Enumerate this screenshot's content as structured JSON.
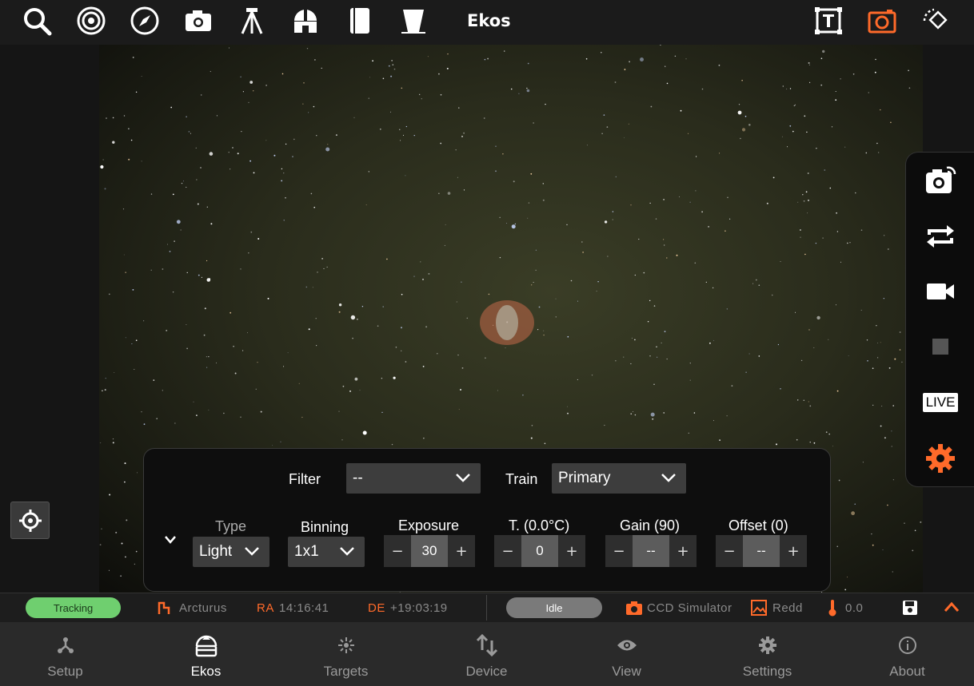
{
  "app": {
    "title": "Ekos"
  },
  "top_icons": [
    "search-icon",
    "target-icon",
    "compass-icon",
    "camera-icon",
    "tripod-icon",
    "observatory-icon",
    "notebook-icon",
    "flat-panel-icon"
  ],
  "top_right_icons": [
    "text-annotation-icon",
    "fov-camera-icon",
    "rotate-view-icon"
  ],
  "side_actions": [
    "capture-preview-icon",
    "loop-icon",
    "video-icon",
    "stop-icon",
    "live-icon",
    "settings-icon"
  ],
  "side": {
    "live_label": "LIVE"
  },
  "capture": {
    "filter_label": "Filter",
    "filter_value": "--",
    "train_label": "Train",
    "train_value": "Primary",
    "type_label": "Type",
    "type_value": "Light",
    "binning_label": "Binning",
    "binning_value": "1x1",
    "exposure_label": "Exposure",
    "exposure_value": "30",
    "temp_label": "T. (0.0°C)",
    "temp_value": "0",
    "gain_label": "Gain (90)",
    "gain_value": "--",
    "offset_label": "Offset (0)",
    "offset_value": "--",
    "minus": "−",
    "plus": "+"
  },
  "status": {
    "tracking": "Tracking",
    "target": "Arcturus",
    "ra_label": "RA",
    "ra_value": "14:16:41",
    "de_label": "DE",
    "de_value": "+19:03:19",
    "idle": "Idle",
    "camera": "CCD Simulator",
    "image_label": "Redd",
    "temperature": "0.0"
  },
  "nav": [
    {
      "label": "Setup",
      "icon": "setup-icon"
    },
    {
      "label": "Ekos",
      "icon": "ekos-dome-icon"
    },
    {
      "label": "Targets",
      "icon": "targets-icon"
    },
    {
      "label": "Device",
      "icon": "device-icon"
    },
    {
      "label": "View",
      "icon": "view-eye-icon"
    },
    {
      "label": "Settings",
      "icon": "settings-gear-icon"
    },
    {
      "label": "About",
      "icon": "about-info-icon"
    }
  ],
  "colors": {
    "accent": "#ff6a2a",
    "tracking_bg": "#6fcf6f",
    "idle_bg": "#7a7a7a"
  }
}
